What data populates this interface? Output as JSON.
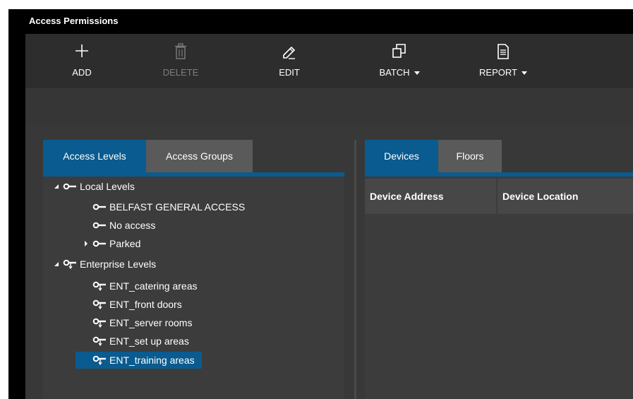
{
  "window": {
    "title": "Access Permissions"
  },
  "toolbar": {
    "add": "ADD",
    "delete": "DELETE",
    "edit": "EDIT",
    "batch": "BATCH",
    "report": "REPORT"
  },
  "left_panel": {
    "tabs": [
      {
        "label": "Access Levels",
        "active": true
      },
      {
        "label": "Access Groups",
        "active": false
      }
    ],
    "tree": {
      "local_levels": "Local Levels",
      "belfast": "BELFAST GENERAL ACCESS",
      "no_access": "No access",
      "parked": "Parked",
      "enterprise_levels": "Enterprise Levels",
      "ent_catering": "ENT_catering areas",
      "ent_front_doors": "ENT_front doors",
      "ent_server_rooms": "ENT_server rooms",
      "ent_set_up": "ENT_set up areas",
      "ent_training": "ENT_training areas"
    }
  },
  "right_panel": {
    "tabs": [
      {
        "label": "Devices",
        "active": true
      },
      {
        "label": "Floors",
        "active": false
      }
    ],
    "columns": [
      "Device Address",
      "Device Location"
    ]
  },
  "colors": {
    "accent": "#0a5b8f",
    "toolbar_bg": "#2d2d2d",
    "panel_bg": "#3c3c3c"
  },
  "icons": {
    "add": "plus-icon",
    "delete": "trash-icon",
    "edit": "pencil-icon",
    "batch": "copy-icon",
    "report": "document-icon",
    "local_key": "key-icon",
    "enterprise_key": "key-arrow-icon"
  }
}
